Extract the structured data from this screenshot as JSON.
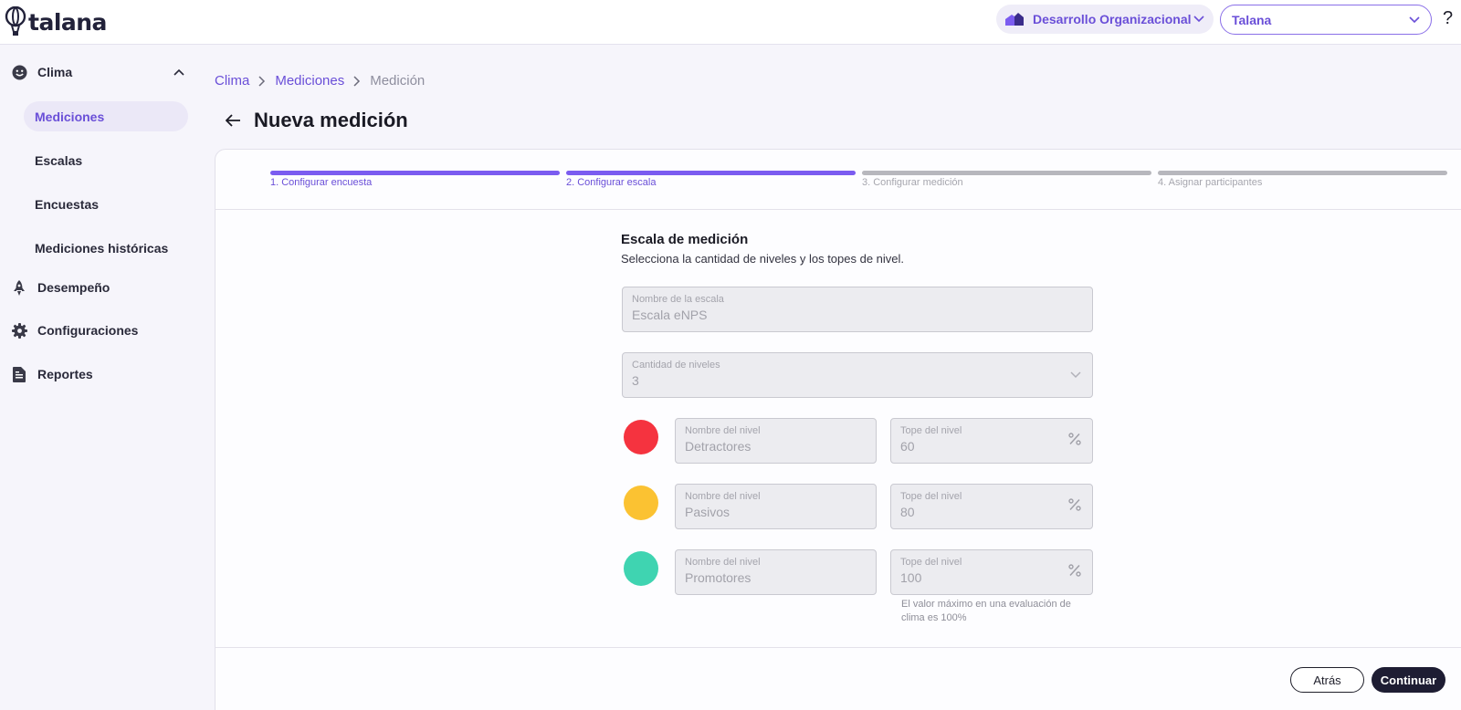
{
  "brand": {
    "name": "talana"
  },
  "header": {
    "org_module": "Desarrollo Organizacional",
    "company": "Talana",
    "help": "?"
  },
  "sidebar": {
    "groups": [
      {
        "label": "Clima",
        "icon": "smiley-face-icon",
        "expanded": true
      },
      {
        "label": "Desempeño",
        "icon": "rocket-icon"
      },
      {
        "label": "Configuraciones",
        "icon": "gear-icon"
      },
      {
        "label": "Reportes",
        "icon": "document-icon"
      }
    ],
    "clima_items": [
      {
        "label": "Mediciones",
        "active": true
      },
      {
        "label": "Escalas"
      },
      {
        "label": "Encuestas"
      },
      {
        "label": "Mediciones históricas"
      }
    ]
  },
  "breadcrumb": {
    "items": [
      "Clima",
      "Mediciones",
      "Medición"
    ]
  },
  "page": {
    "title": "Nueva medición"
  },
  "stepper": {
    "steps": [
      {
        "label": "1. Configurar encuesta",
        "done": true
      },
      {
        "label": "2. Configurar escala",
        "done": true
      },
      {
        "label": "3. Configurar medición",
        "done": false
      },
      {
        "label": "4. Asignar participantes",
        "done": false
      }
    ]
  },
  "form": {
    "title": "Escala de medición",
    "subtitle": "Selecciona la cantidad de niveles y los topes de nivel.",
    "scale_name": {
      "label": "Nombre de la escala",
      "value": "Escala eNPS"
    },
    "levels_count": {
      "label": "Cantidad de niveles",
      "value": "3"
    },
    "levels": [
      {
        "color": "#f5333f",
        "name_label": "Nombre del nivel",
        "name": "Detractores",
        "cap_label": "Tope del nivel",
        "cap": "60"
      },
      {
        "color": "#fbc232",
        "name_label": "Nombre del nivel",
        "name": "Pasivos",
        "cap_label": "Tope del nivel",
        "cap": "80"
      },
      {
        "color": "#3fd4b1",
        "name_label": "Nombre del nivel",
        "name": "Promotores",
        "cap_label": "Tope del nivel",
        "cap": "100"
      }
    ],
    "hint": "El valor máximo en una evaluación de clima es 100%"
  },
  "actions": {
    "back": "Atrás",
    "next": "Continuar"
  },
  "colors": {
    "accent": "#7b5cf0",
    "accent_text": "#6a4fd8",
    "primary_button": "#1e1d33"
  }
}
